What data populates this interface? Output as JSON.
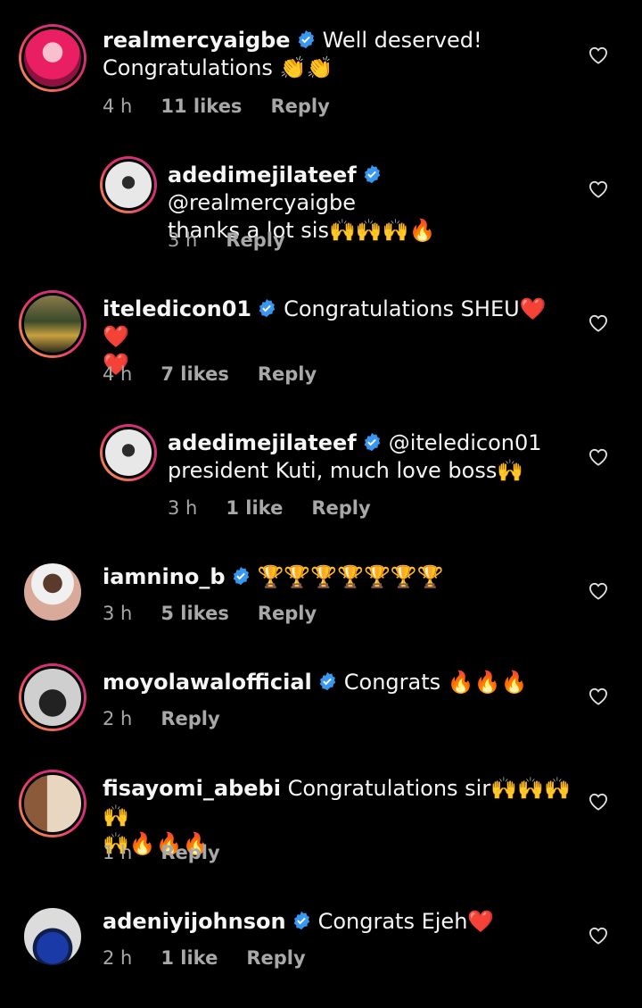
{
  "comments": [
    {
      "username": "realmercyaigbe",
      "verified": true,
      "text_line1": "Well deserved!",
      "text_line2": "Congratulations 👏👏",
      "time": "4 h",
      "likes": "11 likes",
      "reply": "Reply",
      "avatar_colors": [
        "#f06292",
        "#b0306a"
      ]
    },
    {
      "username": "adedimejilateef",
      "verified": true,
      "text_line1": "@realmercyaigbe",
      "text_line2": "thanks a lot sis🙌🙌🙌🔥",
      "time": "3 h",
      "likes": "",
      "reply": "Reply",
      "avatar_colors": [
        "#e8e8e8",
        "#2b2b2b"
      ]
    },
    {
      "username": "iteledicon01",
      "verified": true,
      "text_line1": "Congratulations SHEU❤️❤️",
      "text_line2": "❤️",
      "time": "4 h",
      "likes": "7 likes",
      "reply": "Reply",
      "avatar_colors": [
        "#3a4a2a",
        "#c8a040"
      ]
    },
    {
      "username": "adedimejilateef",
      "verified": true,
      "text_line1": "@iteledicon01",
      "text_line2": "president Kuti, much love boss🙌",
      "time": "3 h",
      "likes": "1 like",
      "reply": "Reply",
      "avatar_colors": [
        "#e8e8e8",
        "#2b2b2b"
      ]
    },
    {
      "username": "iamnino_b",
      "verified": true,
      "text_line1": "🏆🏆🏆🏆🏆🏆🏆",
      "text_line2": "",
      "time": "3 h",
      "likes": "5 likes",
      "reply": "Reply",
      "avatar_colors": [
        "#d9a99a",
        "#7a4a3a"
      ]
    },
    {
      "username": "moyolawalofficial",
      "verified": true,
      "text_line1": "Congrats 🔥🔥🔥",
      "text_line2": "",
      "time": "2 h",
      "likes": "",
      "reply": "Reply",
      "avatar_colors": [
        "#cfcfcf",
        "#222222"
      ]
    },
    {
      "username": "fisayomi_abebi",
      "verified": false,
      "text_line1": "Congratulations sir🙌🙌🙌🙌",
      "text_line2": "🙌🔥🔥🔥",
      "time": "1 h",
      "likes": "",
      "reply": "Reply",
      "avatar_colors": [
        "#e9d6c0",
        "#8a5a3a"
      ]
    },
    {
      "username": "adeniyijohnson",
      "verified": true,
      "text_line1": "Congrats Ejeh❤️",
      "text_line2": "",
      "time": "2 h",
      "likes": "1 like",
      "reply": "Reply",
      "avatar_colors": [
        "#3a5fc8",
        "#0f1f4a"
      ]
    }
  ]
}
